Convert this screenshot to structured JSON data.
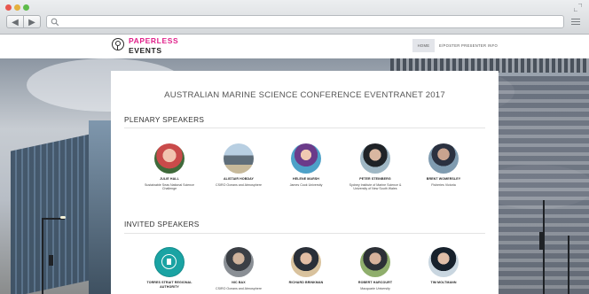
{
  "browser": {
    "address_value": "",
    "back_label": "◀",
    "forward_label": "▶"
  },
  "site": {
    "logo_line1": "PAPERLESS",
    "logo_line2": "EVENTS",
    "nav": [
      "HOME",
      "E/POSTER PRESENTER INFO"
    ],
    "brand_color": "#e0218a"
  },
  "page": {
    "title": "AUSTRALIAN MARINE SCIENCE CONFERENCE EVENTRANET 2017",
    "plenary_heading": "PLENARY SPEAKERS",
    "invited_heading": "INVITED SPEAKERS"
  },
  "plenary": [
    {
      "name": "JULIE HALL",
      "affiliation": "Sustainable Seas National Science Challenge"
    },
    {
      "name": "ALISTAIR HOBDAY",
      "affiliation": "CSIRO Oceans and Atmosphere"
    },
    {
      "name": "HELENE MARSH",
      "affiliation": "James Cook University"
    },
    {
      "name": "PETER STEINBERG",
      "affiliation": "Sydney Institute of Marine Science & University of New South Wales"
    },
    {
      "name": "BRENT WOMERSLEY",
      "affiliation": "Fisheries Victoria"
    }
  ],
  "invited": [
    {
      "name": "TORRES STRAIT REGIONAL AUTHORITY",
      "affiliation": ""
    },
    {
      "name": "NIC BAX",
      "affiliation": "CSIRO Oceans and Atmosphere"
    },
    {
      "name": "RICHARD BRINKMAN",
      "affiliation": ""
    },
    {
      "name": "ROBERT HARCOURT",
      "affiliation": "Macquarie University"
    },
    {
      "name": "TIM MOLTMANN",
      "affiliation": ""
    }
  ]
}
